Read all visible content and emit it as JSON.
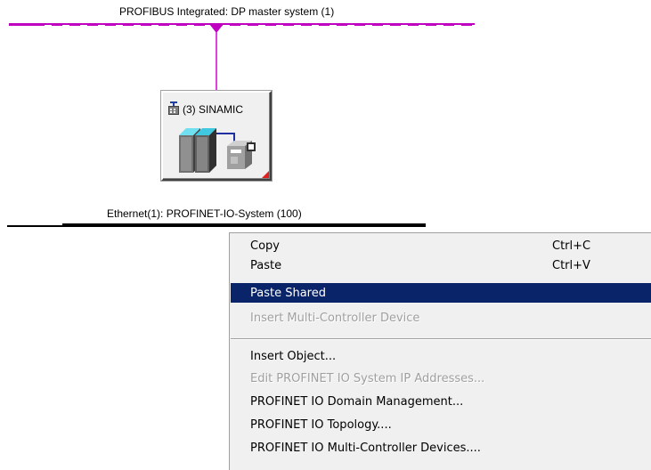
{
  "network": {
    "profibus_label": "PROFIBUS Integrated: DP master system (1)",
    "ethernet_label": "Ethernet(1): PROFINET-IO-System (100)",
    "profibus_color": "#c000c0",
    "ethernet_color": "#000000"
  },
  "device": {
    "title": "(3) SINAMIC",
    "icon": "drive-station-icon"
  },
  "context_menu": {
    "items": [
      {
        "label": "Copy",
        "shortcut": "Ctrl+C",
        "enabled": true
      },
      {
        "label": "Paste",
        "shortcut": "Ctrl+V",
        "enabled": true
      },
      {
        "label": "Paste Shared",
        "shortcut": "",
        "enabled": true,
        "highlighted": true
      },
      {
        "label": "Insert Multi-Controller Device",
        "shortcut": "",
        "enabled": false
      },
      {
        "label": "Insert Object...",
        "shortcut": "",
        "enabled": true
      },
      {
        "label": "Edit PROFINET IO System IP Addresses...",
        "shortcut": "",
        "enabled": false
      },
      {
        "label": "PROFINET IO Domain Management...",
        "shortcut": "",
        "enabled": true
      },
      {
        "label": "PROFINET IO Topology....",
        "shortcut": "",
        "enabled": true
      },
      {
        "label": "PROFINET IO Multi-Controller Devices....",
        "shortcut": "",
        "enabled": true
      }
    ],
    "highlight_color": "#0a246a"
  }
}
